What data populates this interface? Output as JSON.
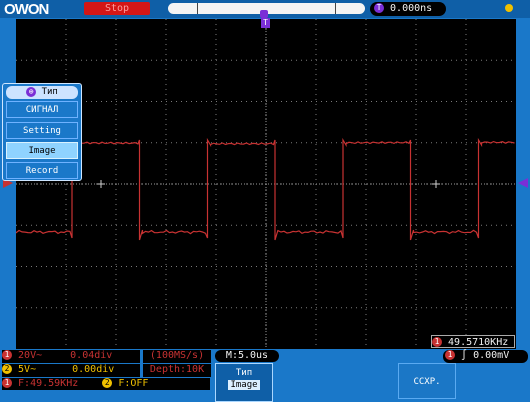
{
  "header": {
    "logo": "OWON",
    "run_state": "Stop",
    "trigger_delay": "0.000ns",
    "trigger_delay_marker": "T"
  },
  "menu": {
    "title": "Тип",
    "items": [
      "СИГНАЛ",
      "Setting",
      "Image",
      "Record"
    ],
    "selected_index": 2
  },
  "channels": [
    {
      "num": "1",
      "coupling": "20V~",
      "scale": "0.04div"
    },
    {
      "num": "2",
      "coupling": "5V~",
      "scale": "0.00div"
    }
  ],
  "acquisition": {
    "rate": "(100MS/s)",
    "depth": "Depth:10K"
  },
  "timebase": "M:5.0us",
  "trigger": {
    "level_text": "0.00mV",
    "freq_display": "49.5710KHz"
  },
  "freq_line": {
    "ch1": "F:49.59KHz",
    "ch2": "F:OFF"
  },
  "softkeys": {
    "key1_title": "Тип",
    "key1_value": "Image",
    "key2": "CCXP."
  },
  "colors": {
    "ch1": "#c83232",
    "ch2": "#f0c000",
    "screen_bg": "#000000",
    "frame": "#1a78c9"
  }
}
